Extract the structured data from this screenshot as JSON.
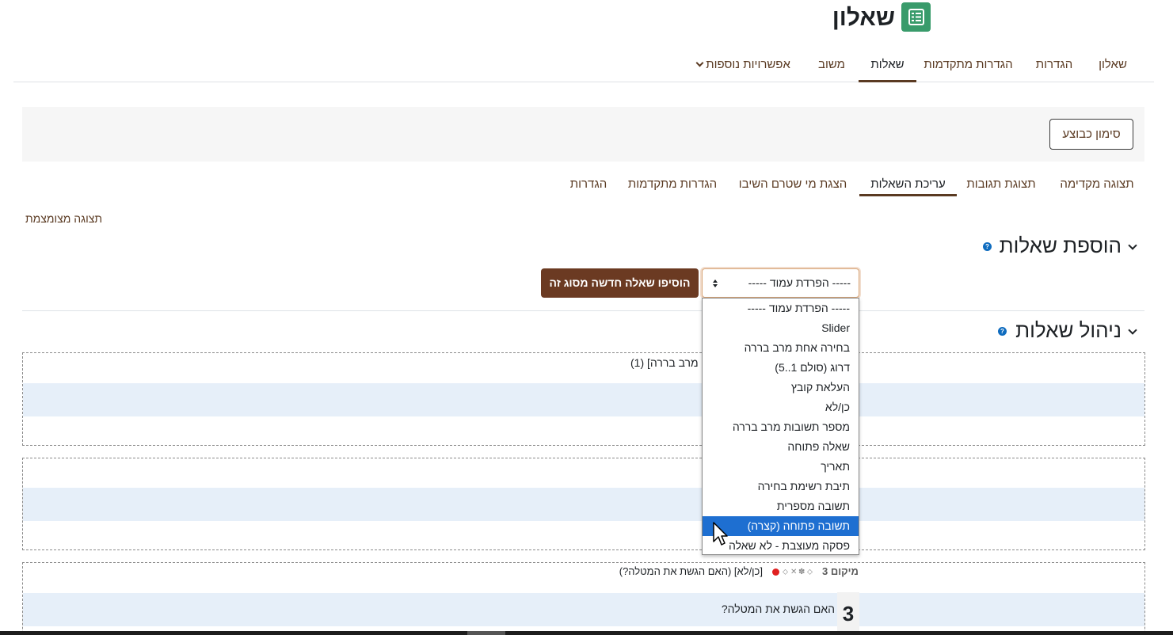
{
  "header": {
    "title": "שאלון",
    "icon": "questionnaire-icon",
    "icon_color": "#399b6b"
  },
  "primary_tabs": [
    {
      "label": "שאלון"
    },
    {
      "label": "הגדרות"
    },
    {
      "label": "הגדרות מתקדמות"
    },
    {
      "label": "שאלות",
      "active": true
    },
    {
      "label": "משוב"
    },
    {
      "label": "אפשרויות נוספות"
    }
  ],
  "mark_done_button": "סימון כבוצע",
  "secondary_tabs": [
    {
      "label": "תצוגה מקדימה"
    },
    {
      "label": "תצוגת תגובות"
    },
    {
      "label": "עריכת השאלות",
      "active": true
    },
    {
      "label": "הצגת מי שטרם השיבו"
    },
    {
      "label": "הגדרות מתקדמות"
    },
    {
      "label": "הגדרות"
    }
  ],
  "compact_view_link": "תצוגה מצומצמת",
  "add_section": {
    "title": "הוספת שאלות",
    "select_value": "----- הפרדת עמוד -----",
    "add_button": "הוסיפו שאלה חדשה מסוג זה",
    "options": [
      "----- הפרדת עמוד -----",
      "Slider",
      "בחירה אחת מרב בררה",
      "דרוג (סולם 1..5)",
      "העלאת קובץ",
      "כן/לא",
      "מספר תשובות מרב בררה",
      "שאלה פתוחה",
      "תאריך",
      "תיבת רשימת בחירה",
      "תשובה מספרית",
      "תשובה פתוחה (קצרה)",
      "פסקה מעוצבת - לא שאלה"
    ],
    "selected_option": "תשובה פתוחה (קצרה)"
  },
  "manage_section": {
    "title": "ניהול שאלות"
  },
  "questions": [
    {
      "header_fragment": "מרב בררה] (1)"
    },
    {
      "header_fragment": ""
    },
    {
      "position_label": "מיקום 3",
      "header": "[כן/לא] (האם הגשת את המטלה?)",
      "number": "3",
      "text": "האם הגשת את המטלה?"
    }
  ],
  "colors": {
    "accent": "#6b3a22",
    "link": "#5a3a22",
    "selected_option_bg": "#1e6fd1",
    "question_band": "#e6eff9"
  }
}
